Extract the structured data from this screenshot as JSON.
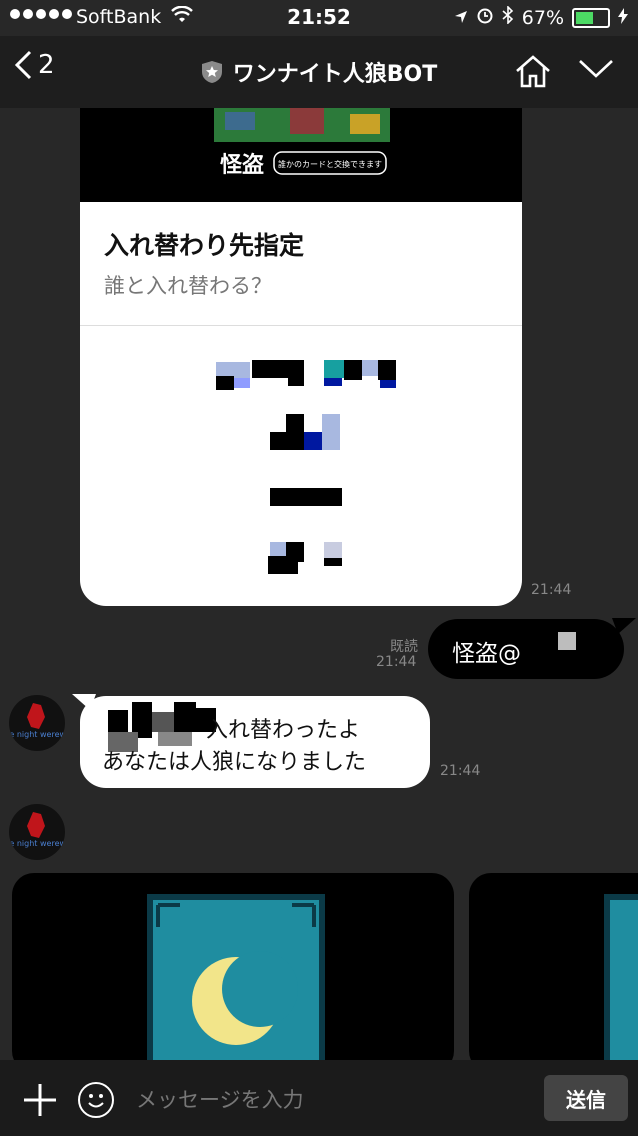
{
  "status_bar": {
    "carrier": "SoftBank",
    "time": "21:52",
    "battery": "67%",
    "battery_level": 0.67
  },
  "header": {
    "back_count": "2",
    "title": "ワンナイト人狼BOT"
  },
  "card": {
    "image_caption": "怪盗",
    "image_badge": "誰かのカードと交換できます",
    "heading": "入れ替わり先指定",
    "subheading": "誰と入れ替わる？",
    "time": "21:44"
  },
  "outgoing": {
    "text": "怪盗@",
    "read_label": "既読",
    "time": "21:44"
  },
  "incoming": {
    "line1": "入れ替わったよ",
    "line2": "あなたは人狼になりました",
    "time": "21:44",
    "avatar_text": "One night werewolf"
  },
  "input_bar": {
    "placeholder": "メッセージを入力",
    "send_label": "送信"
  },
  "colors": {
    "background": "#282828",
    "header": "#1e1e1e",
    "card_teal": "#1f8da0",
    "moon": "#f2e58a",
    "battery_green": "#4cd964"
  }
}
